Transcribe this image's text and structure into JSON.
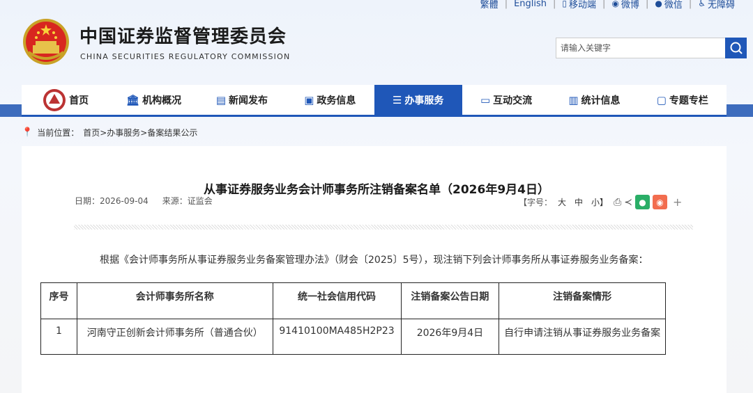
{
  "top_links": {
    "traditional": "繁體",
    "english": "English",
    "mobile": "移动端",
    "weibo": "微博",
    "wechat": "微信",
    "accessibility": "无障碍"
  },
  "header": {
    "title": "中国证券监督管理委员会",
    "subtitle": "CHINA SECURITIES REGULATORY COMMISSION",
    "search_placeholder": "请输入关键字"
  },
  "nav": [
    {
      "label": "首页",
      "icon": "home-emblem-icon"
    },
    {
      "label": "机构概况",
      "icon": "building-icon"
    },
    {
      "label": "新闻发布",
      "icon": "news-icon"
    },
    {
      "label": "政务信息",
      "icon": "monitor-icon"
    },
    {
      "label": "办事服务",
      "icon": "service-icon",
      "active": true
    },
    {
      "label": "互动交流",
      "icon": "chat-icon"
    },
    {
      "label": "统计信息",
      "icon": "chart-icon"
    },
    {
      "label": "专题专栏",
      "icon": "topic-icon"
    }
  ],
  "breadcrumb": {
    "prefix": "当前位置：",
    "path": "首页>办事服务>备案结果公示"
  },
  "article": {
    "title": "从事证券服务业务会计师事务所注销备案名单（2026年9月4日）",
    "date": "日期：2026-09-04",
    "source": "来源：证监会",
    "font_label": "【字号：",
    "font_large": "大",
    "font_medium": "中",
    "font_small": "小】",
    "plus": "+",
    "intro": "根据《会计师事务所从事证券服务业务备案管理办法》（财会〔2025〕5号），现注销下列会计师事务所从事证券服务业务备案："
  },
  "table": {
    "headers": [
      "序号",
      "会计师事务所名称",
      "统一社会信用代码",
      "注销备案公告日期",
      "注销备案情形"
    ],
    "rows": [
      [
        "1",
        "河南守正创新会计师事务所（普通合伙）",
        "91410100MA485H2P23",
        "2026年9月4日",
        "自行申请注销从事证券服务业务备案"
      ]
    ]
  },
  "colors": {
    "primary": "#1f57b8",
    "wechat_green": "#2aae67",
    "weibo_orange": "#f26d4f"
  }
}
